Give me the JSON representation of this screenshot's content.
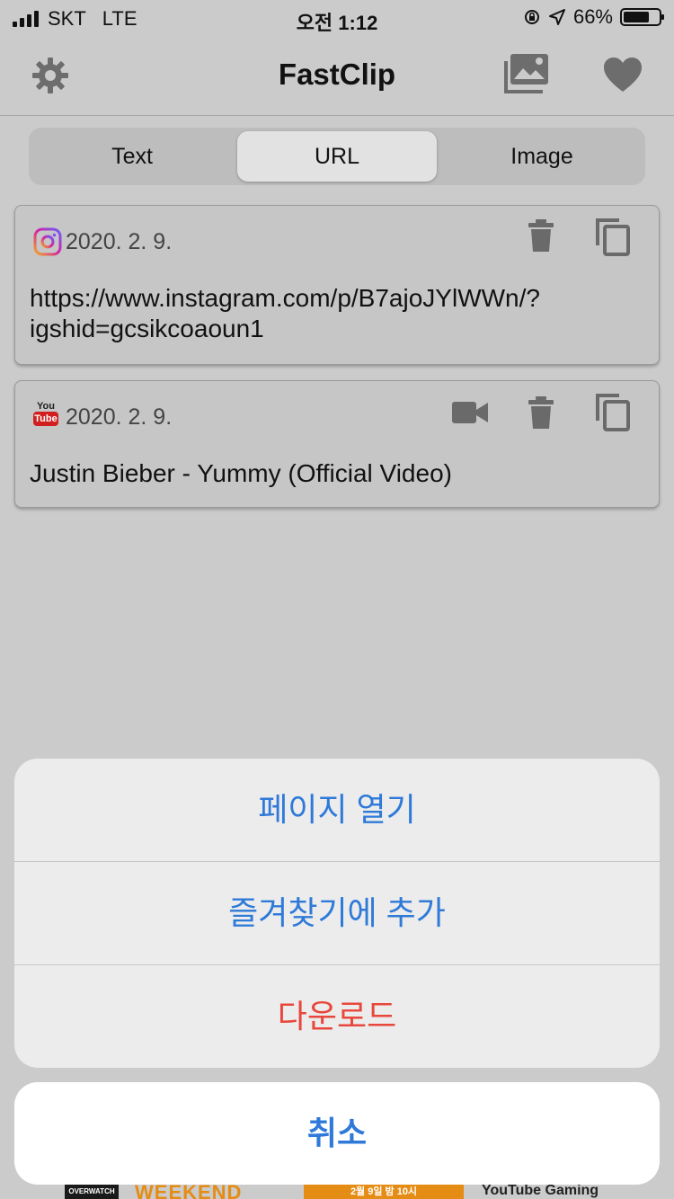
{
  "status_bar": {
    "carrier": "SKT",
    "network": "LTE",
    "time": "오전 1:12",
    "battery": "66%"
  },
  "nav": {
    "title": "FastClip",
    "settings_icon": "gear-icon",
    "gallery_icon": "photos-icon",
    "favorites_icon": "heart-icon"
  },
  "tabs": [
    {
      "label": "Text",
      "active": false
    },
    {
      "label": "URL",
      "active": true
    },
    {
      "label": "Image",
      "active": false
    }
  ],
  "clips": [
    {
      "source": "instagram",
      "date": "2020. 2. 9.",
      "line1": "https://www.instagram.com/p/B7ajoJYlWWn/?",
      "line2": "igshid=gcsikcoaoun1"
    },
    {
      "source": "youtube",
      "source_badge_top": "You",
      "source_badge_bottom": "Tube",
      "date": "2020. 2. 9.",
      "line1": "Justin Bieber - Yummy (Official Video)"
    }
  ],
  "action_sheet": {
    "options": [
      "페이지 열기",
      "즐겨찾기에 추가",
      "다운로드"
    ],
    "cancel": "취소"
  },
  "banner": {
    "brand": "OVERWATCH",
    "headline": "WEEKEND",
    "date_text": "2월 9일 밤 10시",
    "channel": "YouTube Gaming"
  },
  "colors": {
    "action_blue": "#2f7ad9",
    "destructive_red": "#e8483c",
    "overlay_gray": "#cbcbcb"
  }
}
